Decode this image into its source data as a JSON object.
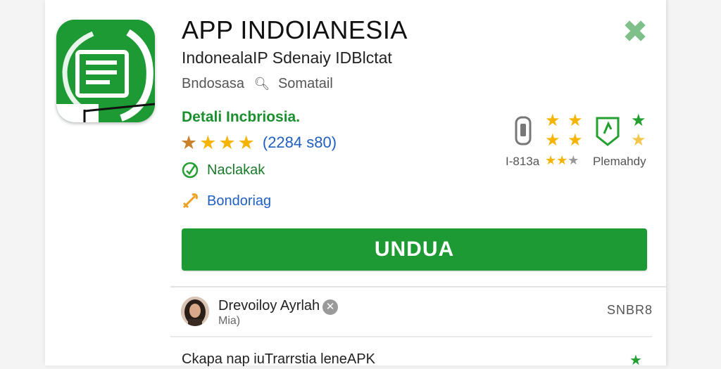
{
  "header": {
    "title": "APP INDOIANESIA",
    "subtitle": "IndonealaIP Sdenaiy IDBlctat",
    "developer_short": "Bndosasa",
    "developer_extra": "Somatail"
  },
  "details": {
    "heading": "Detali Incbriosia.",
    "rating_count": "(2284 s80)",
    "feature1": "Naclakak",
    "feature2": "Bondoriag"
  },
  "side_stats": {
    "left_label": "I-813a",
    "right_label": "Plemahdy"
  },
  "download": {
    "label": "UNDUA"
  },
  "developer": {
    "name": "Drevoiloy Ayrlah",
    "sub": "Mia)",
    "size": "SNBR8"
  },
  "bottom": {
    "text": "Ckapa nap iuTrarrstia leneAPK"
  },
  "colors": {
    "brand_green": "#1d9a34",
    "star_yellow": "#f6b400",
    "link_blue": "#1f5fc0"
  },
  "icons": {
    "close": "close-x-icon",
    "rating": "star-icon",
    "feature1": "check-leaf-icon",
    "feature2": "tool-icon"
  }
}
